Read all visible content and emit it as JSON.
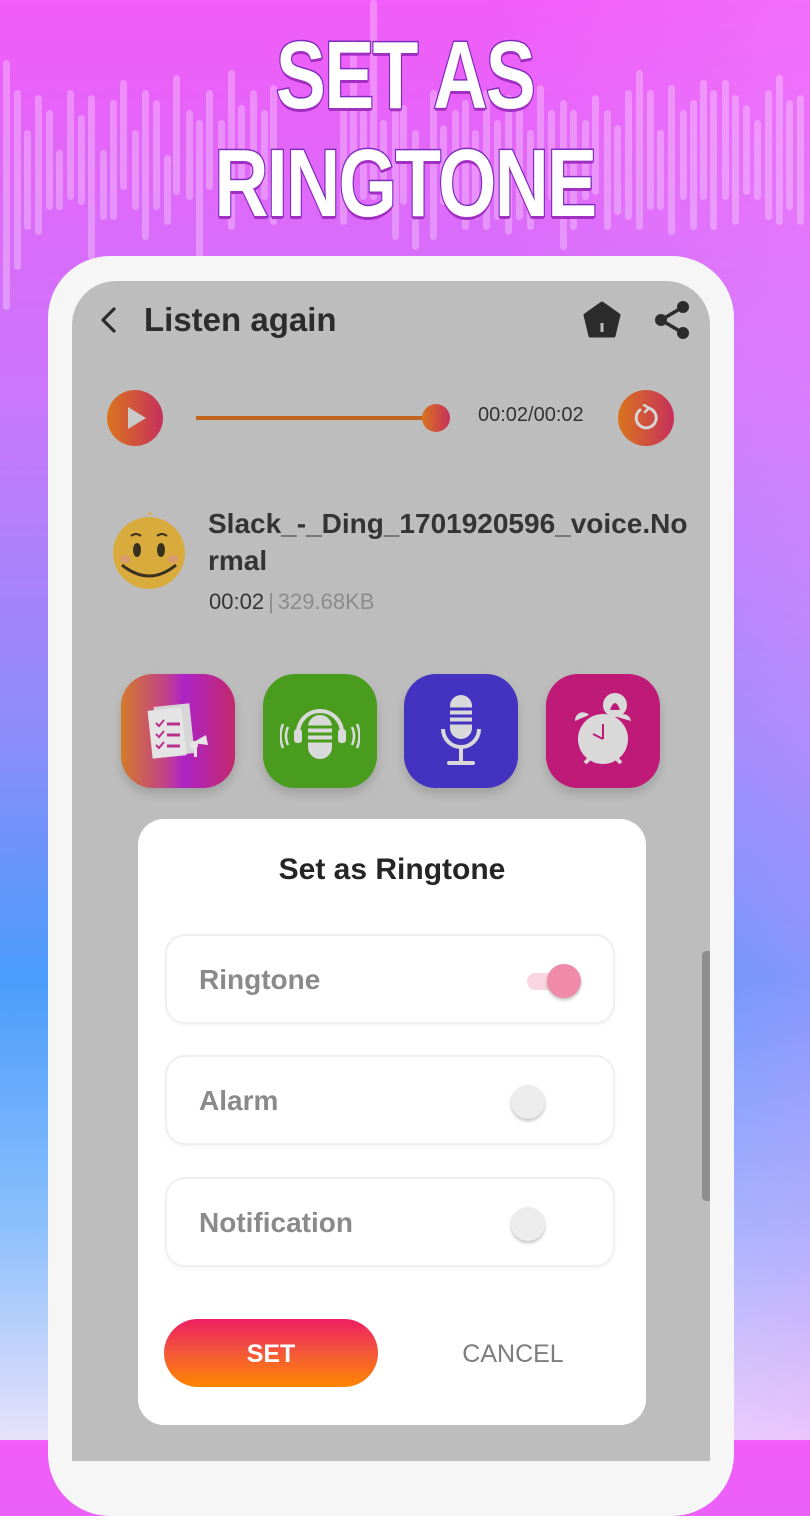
{
  "banner": {
    "line1": "SET AS",
    "line2": "RINGTONE"
  },
  "topbar": {
    "title": "Listen again",
    "back_icon": "chevron-left-icon",
    "home_icon": "home-icon",
    "share_icon": "share-icon"
  },
  "player": {
    "time": "00:02/00:02",
    "progress": 1.0,
    "play_icon": "play-icon",
    "repeat_icon": "repeat-icon"
  },
  "file": {
    "name": "Slack_-_Ding_1701920596_voice.Normal",
    "duration": "00:02",
    "separator": "|",
    "size": "329.68KB",
    "thumb_icon": "smiley-icon"
  },
  "tools": [
    {
      "name": "notes",
      "icon": "document-megaphone-icon",
      "color": "#ae23c6"
    },
    {
      "name": "podcast",
      "icon": "podcast-mic-icon",
      "color": "#4a9c1f"
    },
    {
      "name": "voice-recorder",
      "icon": "microphone-icon",
      "color": "#4433c0"
    },
    {
      "name": "alarm",
      "icon": "alarm-clock-icon",
      "color": "#bf1a77"
    }
  ],
  "dialog": {
    "title": "Set as Ringtone",
    "options": [
      {
        "label": "Ringtone",
        "checked": true
      },
      {
        "label": "Alarm",
        "checked": false
      },
      {
        "label": "Notification",
        "checked": false
      }
    ],
    "set_label": "SET",
    "cancel_label": "CANCEL"
  },
  "colors": {
    "accent": "#ef8aab",
    "set_gradient_top": "#ee1d62",
    "set_gradient_bottom": "#ff8600",
    "player_accent": "#d9741d"
  }
}
